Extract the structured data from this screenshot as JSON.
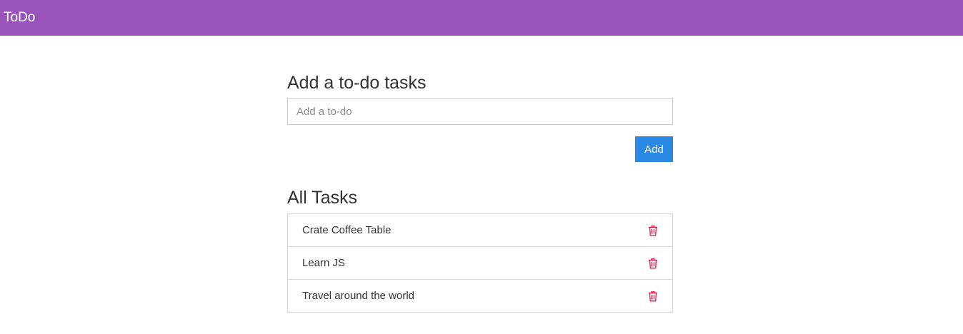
{
  "header": {
    "brand": "ToDo",
    "background_color": "#9954bb"
  },
  "add_section": {
    "title": "Add a to-do tasks",
    "input": {
      "value": "",
      "placeholder": "Add a to-do"
    },
    "add_button": {
      "label": "Add",
      "color": "#2b88e3"
    }
  },
  "tasks_section": {
    "title": "All Tasks",
    "items": [
      {
        "label": "Crate Coffee Table",
        "delete_icon": "trash-icon"
      },
      {
        "label": "Learn JS",
        "delete_icon": "trash-icon"
      },
      {
        "label": "Travel around the world",
        "delete_icon": "trash-icon"
      }
    ],
    "delete_icon_color": "#e8174a"
  }
}
